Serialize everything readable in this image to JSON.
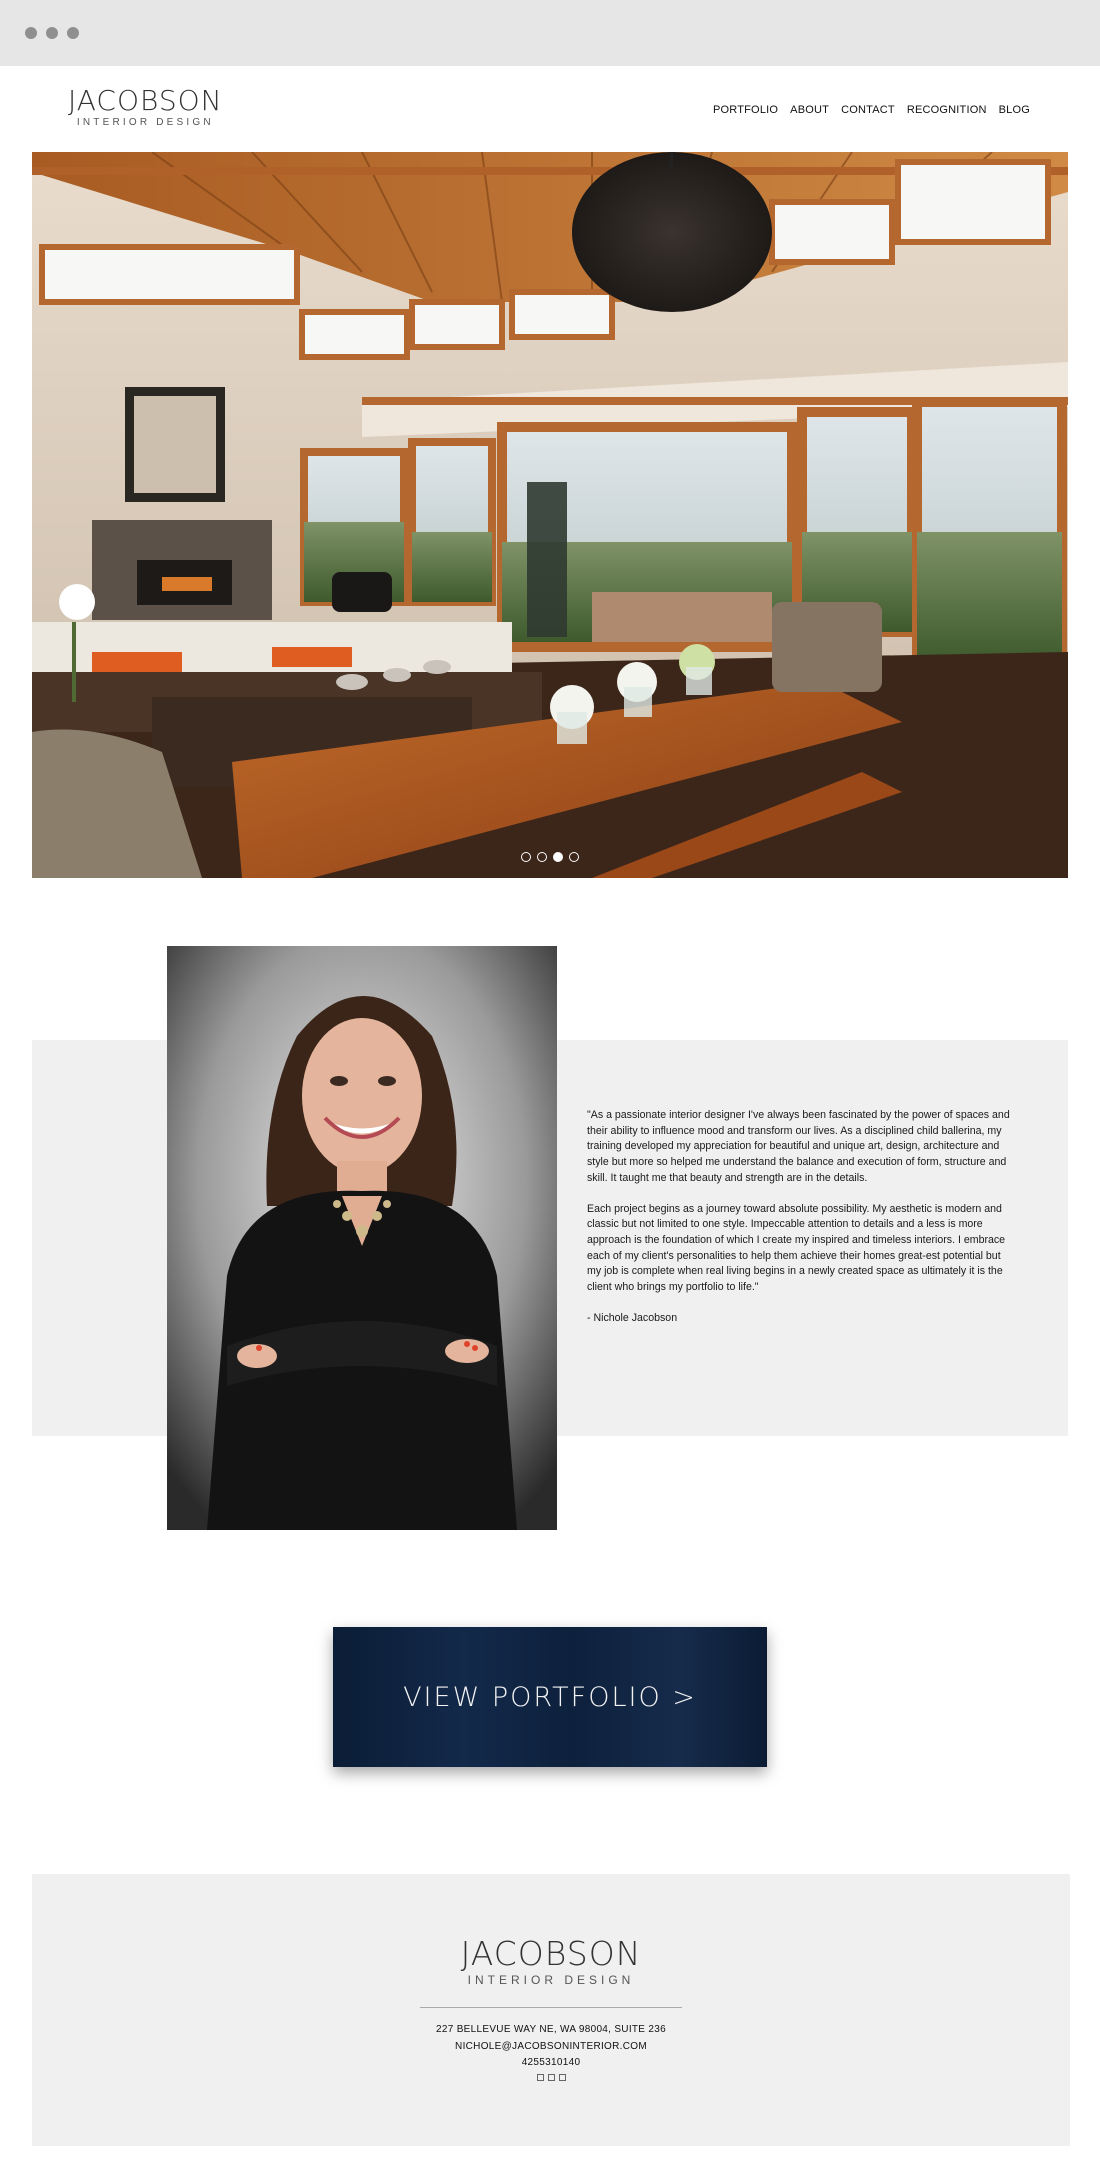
{
  "brand": {
    "name": "JACOBSON",
    "tagline": "INTERIOR DESIGN"
  },
  "nav": [
    {
      "label": "PORTFOLIO"
    },
    {
      "label": "ABOUT"
    },
    {
      "label": "CONTACT"
    },
    {
      "label": "RECOGNITION"
    },
    {
      "label": "BLOG"
    }
  ],
  "carousel": {
    "slide_count": 4,
    "active_index": 2
  },
  "about": {
    "paragraph1": "\"As a passionate interior designer I've always been fascinated by the power of spaces and their ability to influence mood and transform our lives. As a disciplined child ballerina, my training developed my appreciation for beautiful and unique art, design, architecture and style but more so helped me understand the balance and execution of form, structure and skill. It taught me that beauty and strength are in the details.",
    "paragraph2": "Each project begins as a journey toward absolute possibility. My aesthetic is modern and classic but not limited to one style. Impeccable attention to details and a less is more approach is the foundation of which I create my inspired and timeless interiors. I embrace each of my client's personalities to help them achieve their homes great-est potential but my job is complete when real living begins in a newly created space as ultimately it is the client who brings my portfolio to life.\"",
    "signature": "- Nichole Jacobson"
  },
  "cta": {
    "label": "VIEW PORTFOLIO >"
  },
  "footer": {
    "address": "227 BELLEVUE WAY NE, WA 98004, SUITE 236",
    "email": "NICHOLE@JACOBSONINTERIOR.COM",
    "phone": "4255310140"
  },
  "colors": {
    "cta_navy": "#0d213d",
    "band_gray": "#f0f0f0",
    "wood": "#b4672e"
  }
}
